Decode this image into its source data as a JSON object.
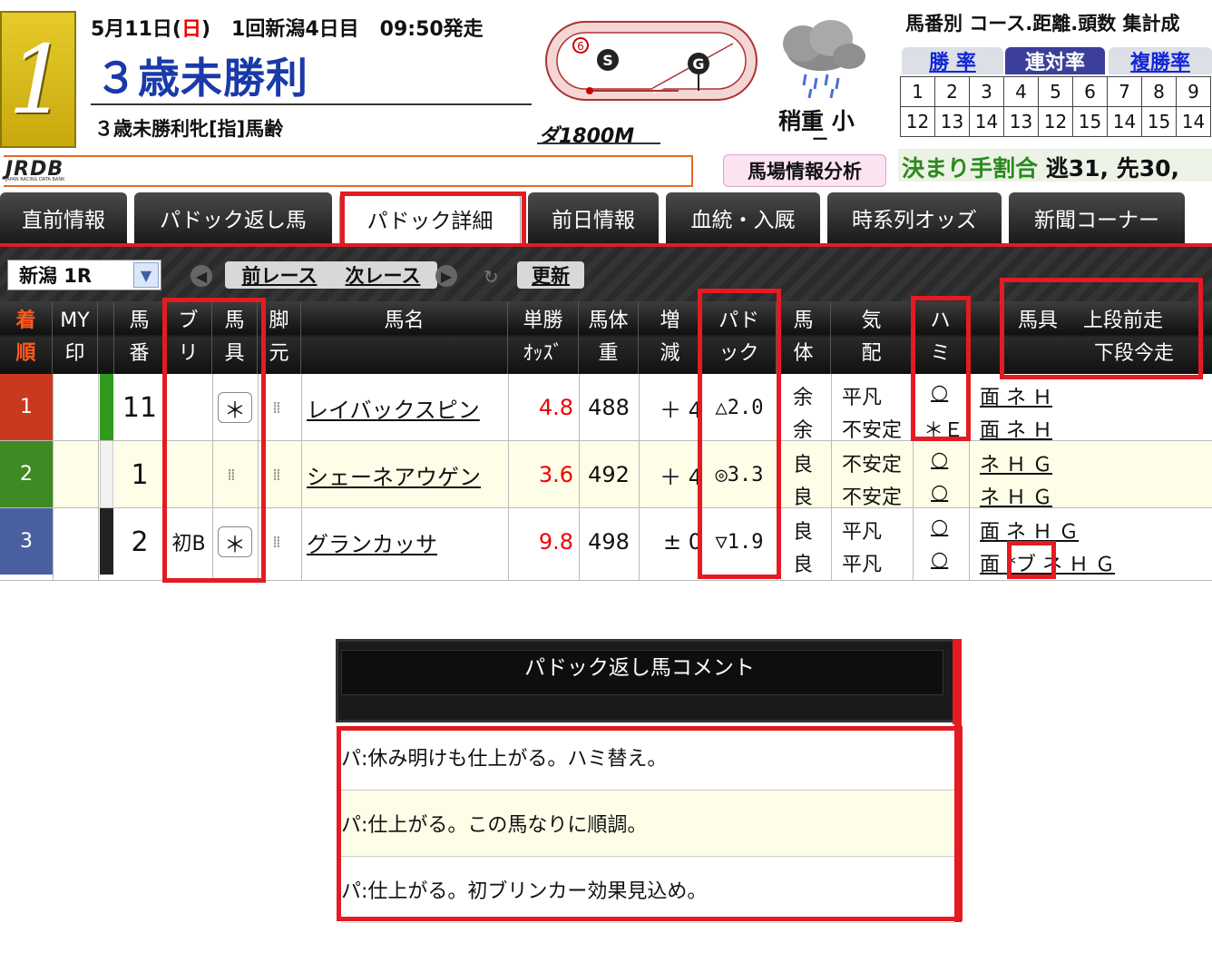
{
  "race": {
    "number": "1",
    "date_month_day": "5月11日(",
    "weekday": "日",
    "date_close": ")",
    "meeting": "1回新潟4日目",
    "post_time": "09:50発走",
    "title": "３歳未勝利",
    "condition": "３歳未勝利牝[指]馬齢",
    "distance": "ダ1800M",
    "gate_marker": "6",
    "start_marker": "S",
    "goal_marker": "G",
    "track_condition": "稍重 小",
    "track_sub": "ー",
    "baba_button": "馬場情報分析"
  },
  "logo": {
    "text": "JRDB",
    "sub": "JAPAN RACING DATA BANK"
  },
  "stats": {
    "title": "馬番別 コース.距離.頭数 集計成",
    "tabs": [
      "勝 率",
      "連対率",
      "複勝率"
    ],
    "active_tab": 1,
    "row1": [
      "1",
      "2",
      "3",
      "4",
      "5",
      "6",
      "7",
      "8",
      "9"
    ],
    "row2": [
      "12",
      "13",
      "14",
      "13",
      "12",
      "15",
      "14",
      "15",
      "14"
    ],
    "kimarite_label": "決まり手割合",
    "kimarite_value": "逃31, 先30,"
  },
  "nav": {
    "tabs": [
      "直前情報",
      "パドック返し馬",
      "パドック詳細",
      "前日情報",
      "血統・入厩",
      "時系列オッズ",
      "新聞コーナー"
    ],
    "active": 2
  },
  "toolbar": {
    "venue": "新潟 1R",
    "prev": "前レース",
    "next": "次レース",
    "refresh": "更新"
  },
  "headers": {
    "rank": [
      "着",
      "順"
    ],
    "my": [
      "MY",
      "印"
    ],
    "umaban": [
      "馬",
      "番"
    ],
    "buri": [
      "ブ",
      "リ"
    ],
    "bagu": [
      "馬",
      "具"
    ],
    "kyaku": [
      "脚",
      "元"
    ],
    "name": "馬名",
    "odds": [
      "単勝",
      "ｵｯｽﾞ"
    ],
    "weight": [
      "馬体",
      "重"
    ],
    "change": [
      "増",
      "減"
    ],
    "paddock": [
      "パド",
      "ック"
    ],
    "body": [
      "馬",
      "体"
    ],
    "kihai": [
      "気",
      "配"
    ],
    "hami": [
      "ハ",
      "ミ"
    ],
    "equip": [
      "馬具",
      "上段前走",
      "下段今走"
    ]
  },
  "rows": [
    {
      "rank": "1",
      "rank_color": "#c8391e",
      "waku_color": "#2f9a1c",
      "umaban": "11",
      "buri": "",
      "bagu": "＊",
      "name": "レイバックスピン",
      "odds": "4.8",
      "weight": "488",
      "change": "＋ 4",
      "paddock": "△2.0",
      "body1": "余",
      "body2": "余",
      "kihai1": "平凡",
      "kihai2": "不安定",
      "hami1": "○",
      "hami2": "＊Ｅ",
      "equip1": "面 ネ Ｈ",
      "equip2": "面 ネ Ｈ",
      "bg": "#ffffff"
    },
    {
      "rank": "2",
      "rank_color": "#3f8a23",
      "waku_color": "#f2f2f2",
      "umaban": "1",
      "buri": "",
      "bagu": "",
      "name": "シェーネアウゲン",
      "odds": "3.6",
      "weight": "492",
      "change": "＋ 4",
      "paddock": "◎3.3",
      "body1": "良",
      "body2": "良",
      "kihai1": "不安定",
      "kihai2": "不安定",
      "hami1": "○",
      "hami2": "○",
      "equip1": "ネ Ｈ Ｇ",
      "equip2": "ネ Ｈ Ｇ",
      "bg": "#fefee8"
    },
    {
      "rank": "3",
      "rank_color": "#4a5fa0",
      "waku_color": "#222222",
      "umaban": "2",
      "buri": "初B",
      "bagu": "＊",
      "name": "グランカッサ",
      "odds": "9.8",
      "weight": "498",
      "change": "± 0",
      "paddock": "▽1.9",
      "body1": "良",
      "body2": "良",
      "kihai1": "平凡",
      "kihai2": "平凡",
      "hami1": "○",
      "hami2": "○",
      "equip1": "面 ネ Ｈ Ｇ",
      "equip2_a": "面 ",
      "equip2_b": "*ブ",
      "equip2_c": " ネ Ｈ Ｇ",
      "bg": "#ffffff"
    }
  ],
  "comments": {
    "title": "パドック返し馬コメント",
    "items": [
      "パ:休み明けも仕上がる。ハミ替え。",
      "パ:仕上がる。この馬なりに順調。",
      "パ:仕上がる。初ブリンカー効果見込め。"
    ]
  }
}
